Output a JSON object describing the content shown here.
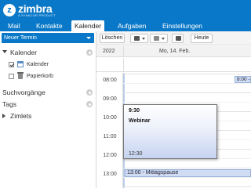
{
  "app": {
    "logo_letter": "z",
    "name": "zimbra",
    "tagline": "A SYNACOR PRODUCT",
    "accent": "#0a78c8"
  },
  "tabs": [
    {
      "label": "Mail",
      "active": false
    },
    {
      "label": "Kontakte",
      "active": false
    },
    {
      "label": "Kalender",
      "active": true
    },
    {
      "label": "Aufgaben",
      "active": false
    },
    {
      "label": "Einstellungen",
      "active": false
    }
  ],
  "sidebar": {
    "new_button": "Neuer Termin",
    "calendars": {
      "label": "Kalender",
      "items": [
        {
          "label": "Kalender",
          "checked": true
        },
        {
          "label": "Papierkorb",
          "checked": false
        }
      ]
    },
    "searches": "Suchvorgänge",
    "tags": "Tags",
    "zimlets": "Zimlets"
  },
  "toolbar": {
    "delete": "Löschen",
    "today": "Heute"
  },
  "calendar": {
    "year": "2022",
    "day": "Mo, 14. Feb.",
    "hours": [
      "08:00",
      "09:00",
      "10:00",
      "11:00",
      "12:00",
      "13:00"
    ],
    "events": {
      "small": "8:00 -",
      "popup_start": "9:30",
      "popup_title": "Webinar",
      "popup_end": "12:30",
      "lunch": "13:00 - Mittagspause"
    }
  }
}
